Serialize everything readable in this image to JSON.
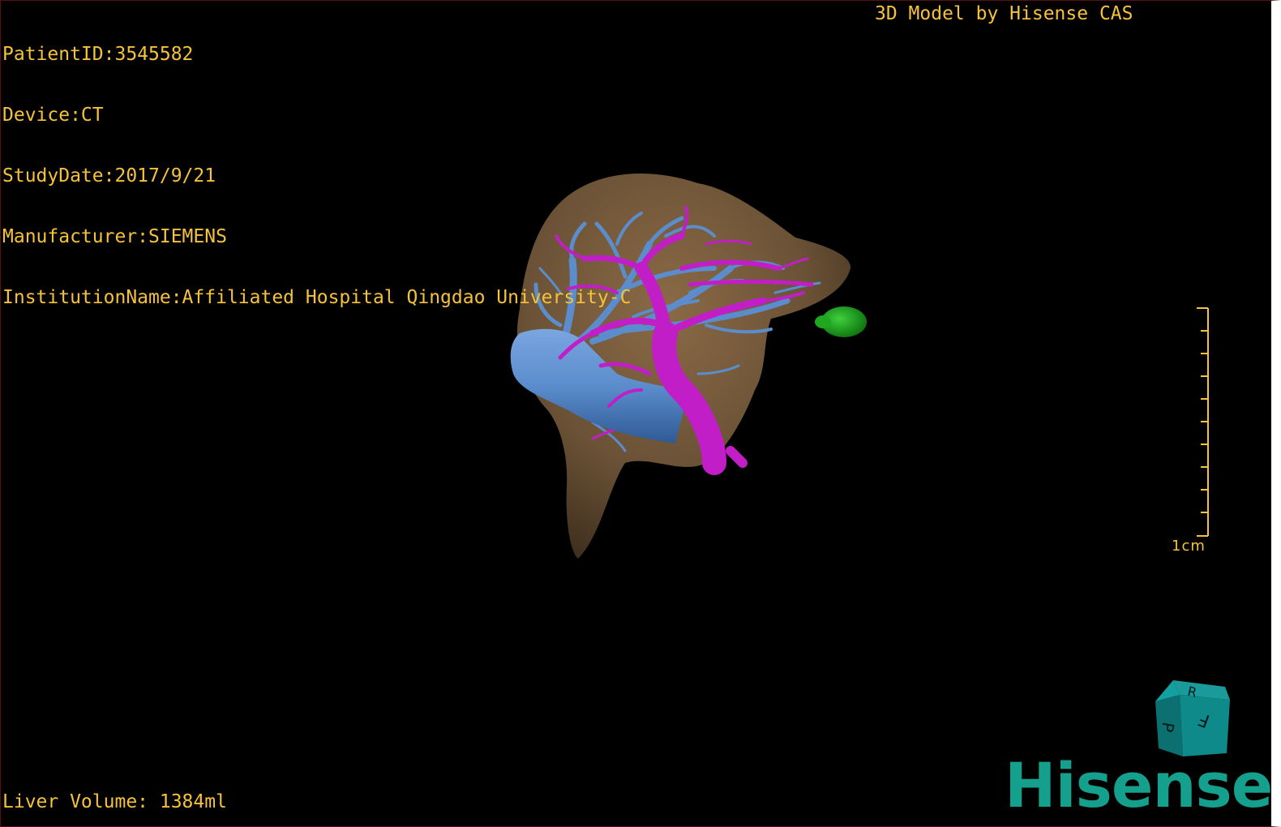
{
  "patient_info": {
    "patient_id": "PatientID:3545582",
    "device": "Device:CT",
    "study_date": "StudyDate:2017/9/21",
    "manufacturer": "Manufacturer:SIEMENS",
    "institution": "InstitutionName:Affiliated Hospital Qingdao University-C"
  },
  "header_right": "3D Model by Hisense CAS",
  "liver_volume": "Liver Volume: 1384ml",
  "scale_label": "1cm",
  "orientation_cube": {
    "labels": [
      "R",
      "F",
      "P"
    ],
    "color": "#0f8a8a"
  },
  "logo": {
    "text": "Hisense",
    "color": "#14a08c"
  },
  "colors": {
    "overlay_text": "#f5c23a",
    "liver": "#6b5236",
    "hepatic_vein": "#5b8ccc",
    "portal_vein": "#c21ec8",
    "gallbladder": "#1ea81e"
  }
}
